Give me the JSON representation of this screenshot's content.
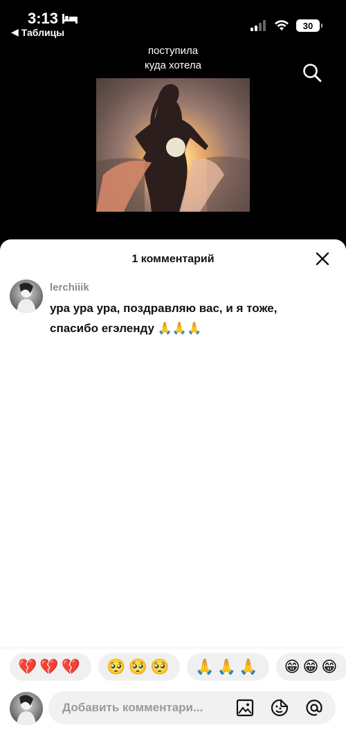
{
  "status_bar": {
    "time": "3:13",
    "back_app": "Таблицы",
    "battery": "30"
  },
  "video": {
    "caption_line1": "поступила",
    "caption_line2": "куда хотела"
  },
  "comments_sheet": {
    "title": "1 комментарий",
    "comments": [
      {
        "username": "lerchiiik",
        "text": " ура ура ура, поздравляю вас, и я тоже, спасибо егэленду 🙏🙏🙏"
      }
    ]
  },
  "reactions": [
    "💔💔💔",
    "🥺🥺🥺",
    "🙏🙏🙏",
    "😁😁😁"
  ],
  "composer": {
    "placeholder": "Добавить комментари..."
  }
}
